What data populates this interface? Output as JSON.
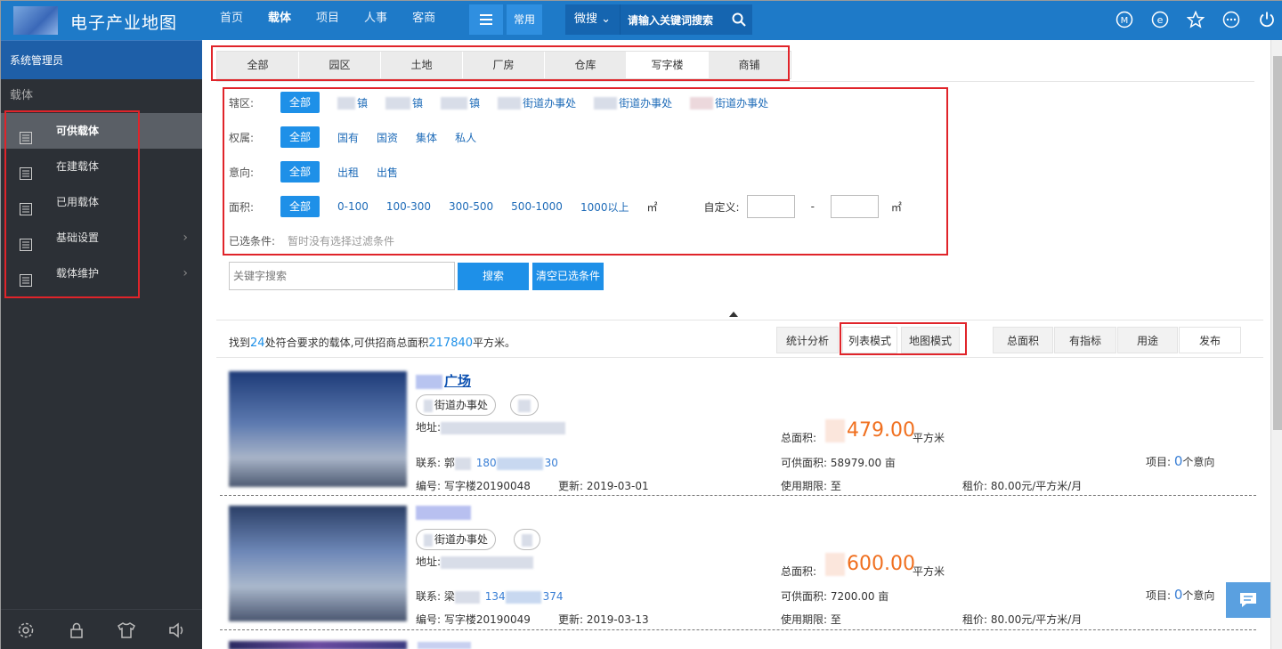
{
  "app": {
    "title": "电子产业地图"
  },
  "nav": {
    "items": [
      "首页",
      "载体",
      "项目",
      "人事",
      "客商"
    ],
    "active": "载体",
    "common_label": "常用"
  },
  "search": {
    "micro_label": "微搜",
    "placeholder": "请输入关键词搜索"
  },
  "top_icons": [
    "m-circle-icon",
    "e-circle-icon",
    "star-icon",
    "more-icon",
    "power-icon"
  ],
  "sidebar": {
    "user": "系统管理员",
    "section": "载体",
    "items": [
      {
        "label": "可供载体",
        "active": true,
        "arrow": false
      },
      {
        "label": "在建载体",
        "active": false,
        "arrow": false
      },
      {
        "label": "已用载体",
        "active": false,
        "arrow": false
      },
      {
        "label": "基础设置",
        "active": false,
        "arrow": true
      },
      {
        "label": "载体维护",
        "active": false,
        "arrow": true
      }
    ],
    "bottom_icons": [
      "gear-icon",
      "lock-icon",
      "shirt-icon",
      "speaker-icon"
    ]
  },
  "tabs": [
    "全部",
    "园区",
    "土地",
    "厂房",
    "仓库",
    "写字楼",
    "商铺"
  ],
  "active_tab": "写字楼",
  "filters": {
    "district": {
      "label": "辖区:",
      "options": [
        "全部",
        "镇",
        "镇",
        "镇",
        "街道办事处",
        "街道办事处",
        "街道办事处"
      ]
    },
    "ownership": {
      "label": "权属:",
      "options": [
        "全部",
        "国有",
        "国资",
        "集体",
        "私人"
      ]
    },
    "intent": {
      "label": "意向:",
      "options": [
        "全部",
        "出租",
        "出售"
      ]
    },
    "area": {
      "label": "面积:",
      "options": [
        "全部",
        "0-100",
        "100-300",
        "300-500",
        "500-1000",
        "1000以上"
      ],
      "unit": "㎡",
      "custom_label": "自定义:",
      "dash": "-"
    },
    "selected": {
      "label": "已选条件:",
      "text": "暂时没有选择过滤条件"
    }
  },
  "keyword": {
    "placeholder": "关键字搜索",
    "search_btn": "搜索",
    "clear_btn": "清空已选条件"
  },
  "summary": {
    "prefix": "找到",
    "count": "24",
    "mid": "处符合要求的载体,可供招商总面积",
    "area": "217840",
    "suffix": "平方米。"
  },
  "mode_buttons": [
    "统计分析",
    "列表模式",
    "地图模式"
  ],
  "sort_buttons": [
    "总面积",
    "有指标",
    "用途",
    "发布"
  ],
  "listings": [
    {
      "title": "广场",
      "chip": "街道办事处",
      "address_label": "地址:",
      "contact_label": "联系:",
      "contact_name": "郭",
      "phone_a": "180",
      "phone_b": "30",
      "code": "编号: 写字楼20190048",
      "updated": "更新: 2019-03-01",
      "total_label": "总面积:",
      "total_area": "479.00",
      "area_unit": "平方米",
      "avail": "可供面积: 58979.00 亩",
      "term": "使用期限: 至",
      "project_label": "项目:",
      "project_count": "0",
      "project_unit": "个意向",
      "rent": "租价: 80.00元/平方米/月"
    },
    {
      "title": "",
      "chip": "街道办事处",
      "address_label": "地址:",
      "contact_label": "联系:",
      "contact_name": "梁",
      "phone_a": "134",
      "phone_b": "374",
      "code": "编号: 写字楼20190049",
      "updated": "更新: 2019-03-13",
      "total_label": "总面积:",
      "total_area": "600.00",
      "area_unit": "平方米",
      "avail": "可供面积: 7200.00 亩",
      "term": "使用期限: 至",
      "project_label": "项目:",
      "project_count": "0",
      "project_unit": "个意向",
      "rent": "租价: 80.00元/平方米/月"
    }
  ],
  "colors": {
    "brand": "#1e7ac8",
    "accent": "#1e90e8",
    "highlight": "#e0242a",
    "price": "#f07020"
  }
}
